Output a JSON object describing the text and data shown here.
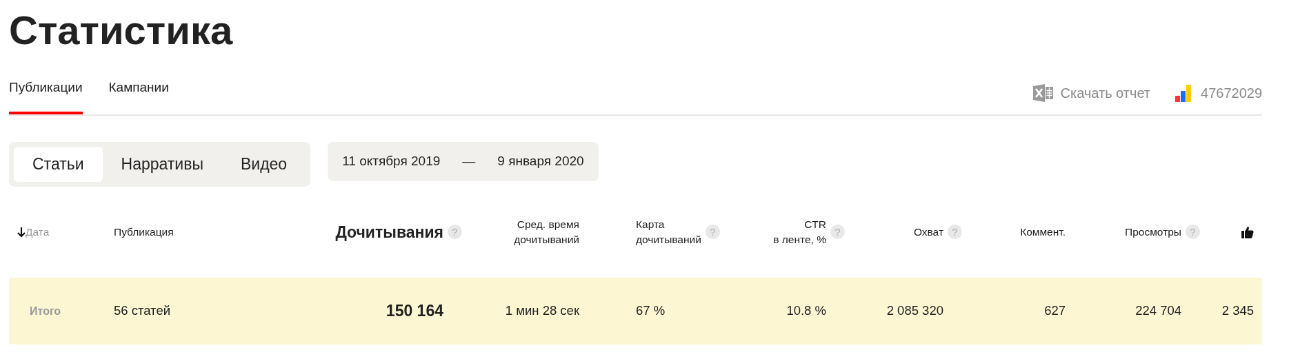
{
  "title": "Статистика",
  "tabs": [
    {
      "label": "Публикации",
      "selected": true
    },
    {
      "label": "Кампании",
      "selected": false
    }
  ],
  "download": {
    "label": "Скачать отчет"
  },
  "account": {
    "id": "47672029"
  },
  "content_types": [
    {
      "label": "Статьи",
      "selected": true
    },
    {
      "label": "Нарративы",
      "selected": false
    },
    {
      "label": "Видео",
      "selected": false
    }
  ],
  "date_range": {
    "from": "11 октября 2019",
    "separator": "—",
    "to": "9 января 2020"
  },
  "table": {
    "columns": [
      {
        "kind": "date",
        "label": "Дата",
        "sorted": true
      },
      {
        "kind": "text",
        "label": "Публикация"
      },
      {
        "kind": "primary",
        "label": "Дочитывания",
        "help": "?"
      },
      {
        "kind": "number",
        "label": "Сред. время",
        "label2": "дочитываний"
      },
      {
        "kind": "left",
        "label": "Карта",
        "label2": "дочитываний",
        "help": "?"
      },
      {
        "kind": "number",
        "label": "CTR",
        "label2": "в ленте, %",
        "help": "?"
      },
      {
        "kind": "number",
        "label": "Охват",
        "help": "?"
      },
      {
        "kind": "number",
        "label": "Коммент."
      },
      {
        "kind": "number",
        "label": "Просмотры",
        "help": "?"
      },
      {
        "kind": "icon"
      }
    ],
    "total_row": [
      "Итого",
      "56 статей",
      "150 164",
      "1 мин 28 сек",
      "67 %",
      "10.8 %",
      "2 085 320",
      "627",
      "224 704",
      "2 345"
    ]
  }
}
